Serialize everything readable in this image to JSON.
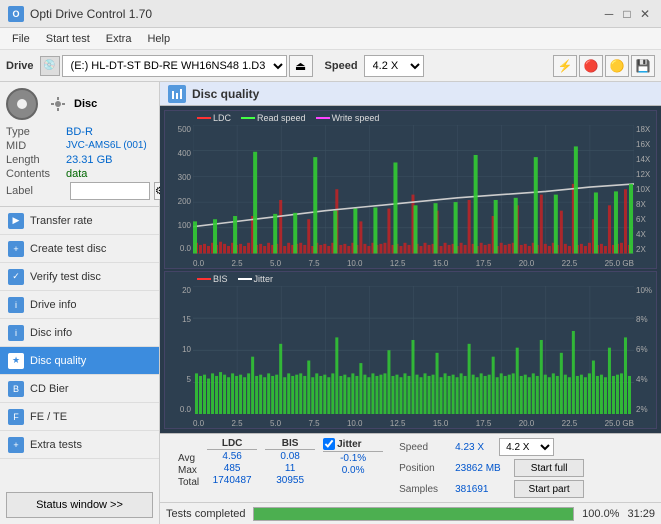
{
  "titleBar": {
    "title": "Opti Drive Control 1.70",
    "icon": "O"
  },
  "menuBar": {
    "items": [
      "File",
      "Start test",
      "Extra",
      "Help"
    ]
  },
  "driveBar": {
    "label": "Drive",
    "driveValue": "(E:)  HL-DT-ST BD-RE  WH16NS48 1.D3",
    "speedLabel": "Speed",
    "speedValue": "4.2 X"
  },
  "disc": {
    "title": "Disc",
    "typeLabel": "Type",
    "typeValue": "BD-R",
    "midLabel": "MID",
    "midValue": "JVC-AMS6L (001)",
    "lengthLabel": "Length",
    "lengthValue": "23.31 GB",
    "contentsLabel": "Contents",
    "contentsValue": "data",
    "labelLabel": "Label",
    "labelValue": ""
  },
  "navItems": [
    {
      "id": "transfer-rate",
      "label": "Transfer rate",
      "active": false
    },
    {
      "id": "create-test-disc",
      "label": "Create test disc",
      "active": false
    },
    {
      "id": "verify-test-disc",
      "label": "Verify test disc",
      "active": false
    },
    {
      "id": "drive-info",
      "label": "Drive info",
      "active": false
    },
    {
      "id": "disc-info",
      "label": "Disc info",
      "active": false
    },
    {
      "id": "disc-quality",
      "label": "Disc quality",
      "active": true
    },
    {
      "id": "cd-bier",
      "label": "CD Bier",
      "active": false
    },
    {
      "id": "fe-te",
      "label": "FE / TE",
      "active": false
    },
    {
      "id": "extra-tests",
      "label": "Extra tests",
      "active": false
    }
  ],
  "statusBtn": "Status window >>",
  "chartPanel": {
    "title": "Disc quality"
  },
  "upperChart": {
    "legendItems": [
      {
        "label": "LDC",
        "color": "#ff4444"
      },
      {
        "label": "Read speed",
        "color": "#44ff44"
      },
      {
        "label": "Write speed",
        "color": "#ff44ff"
      }
    ],
    "yAxisLabels": [
      "500",
      "400",
      "300",
      "200",
      "100",
      "0.0"
    ],
    "yAxisRightLabels": [
      "18X",
      "16X",
      "14X",
      "12X",
      "10X",
      "8X",
      "6X",
      "4X",
      "2X"
    ],
    "xAxisLabels": [
      "0.0",
      "2.5",
      "5.0",
      "7.5",
      "10.0",
      "12.5",
      "15.0",
      "17.5",
      "20.0",
      "22.5",
      "25.0 GB"
    ]
  },
  "lowerChart": {
    "legendItems": [
      {
        "label": "BIS",
        "color": "#ff4444"
      },
      {
        "label": "Jitter",
        "color": "#ffffff"
      }
    ],
    "yAxisLabels": [
      "20",
      "15",
      "10",
      "5",
      "0.0"
    ],
    "yAxisRightLabels": [
      "10%",
      "8%",
      "6%",
      "4%",
      "2%"
    ],
    "xAxisLabels": [
      "0.0",
      "2.5",
      "5.0",
      "7.5",
      "10.0",
      "12.5",
      "15.0",
      "17.5",
      "20.0",
      "22.5",
      "25.0 GB"
    ]
  },
  "stats": {
    "ldcLabel": "LDC",
    "bisLabel": "BIS",
    "jitterLabel": "Jitter",
    "jitterChecked": true,
    "avgRow": {
      "label": "Avg",
      "ldc": "4.56",
      "bis": "0.08",
      "jitter": "-0.1%"
    },
    "maxRow": {
      "label": "Max",
      "ldc": "485",
      "bis": "11",
      "jitter": "0.0%"
    },
    "totalRow": {
      "label": "Total",
      "ldc": "1740487",
      "bis": "30955",
      "jitter": ""
    },
    "speedLabel": "Speed",
    "speedValue": "4.23 X",
    "speedSelectValue": "4.2 X",
    "positionLabel": "Position",
    "positionValue": "23862 MB",
    "samplesLabel": "Samples",
    "samplesValue": "381691",
    "startFullBtn": "Start full",
    "startPartBtn": "Start part"
  },
  "statusBar": {
    "text": "Tests completed",
    "progress": 100,
    "progressText": "100.0%",
    "time": "31:29"
  }
}
